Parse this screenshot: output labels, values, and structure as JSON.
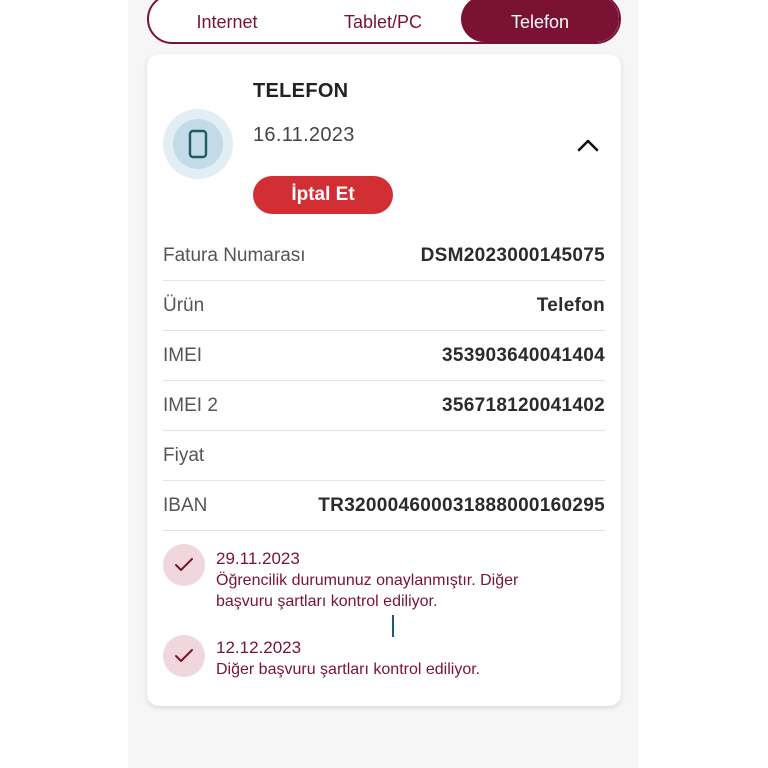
{
  "tabs": [
    {
      "label": "Internet",
      "active": false
    },
    {
      "label": "Tablet/PC",
      "active": false
    },
    {
      "label": "Telefon",
      "active": true
    }
  ],
  "card": {
    "title": "TELEFON",
    "date": "16.11.2023",
    "cancel_label": "İptal Et",
    "device_icon": "phone-icon",
    "collapse_icon": "chevron-up-icon"
  },
  "details": [
    {
      "label": "Fatura Numarası",
      "value": "DSM2023000145075"
    },
    {
      "label": "Ürün",
      "value": "Telefon"
    },
    {
      "label": "IMEI",
      "value": "353903640041404"
    },
    {
      "label": "IMEI 2",
      "value": "356718120041402"
    },
    {
      "label": "Fiyat",
      "value": ""
    },
    {
      "label": "IBAN",
      "value": "TR320004600031888000160295"
    }
  ],
  "timeline": [
    {
      "date": "29.11.2023",
      "line1": "Öğrencilik durumunuz onaylanmıştır. Diğer",
      "line2": "başvuru şartları kontrol ediliyor."
    },
    {
      "date": "12.12.2023",
      "line1": "Diğer başvuru şartları kontrol ediliyor.",
      "line2": ""
    }
  ],
  "colors": {
    "brand": "#7a1333",
    "danger": "#d22f35",
    "check_bg": "#efd7dd",
    "device_bg": "#c3dbe6"
  }
}
